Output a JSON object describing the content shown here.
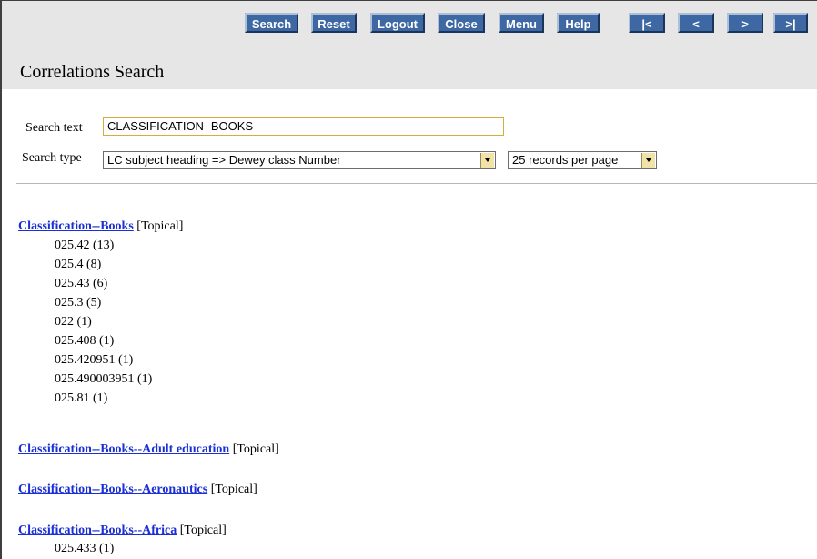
{
  "toolbar": {
    "buttons": [
      "Search",
      "Reset",
      "Logout",
      "Close",
      "Menu",
      "Help"
    ],
    "nav": [
      "|<",
      "<",
      ">",
      ">|"
    ]
  },
  "page_title": "Correlations Search",
  "search": {
    "text_label": "Search text",
    "text_value": "CLASSIFICATION- BOOKS",
    "type_label": "Search type",
    "type_value": "LC subject heading => Dewey class Number",
    "per_page_value": "25 records per page"
  },
  "results": [
    {
      "heading": "Classification--Books",
      "tag": "[Topical]",
      "numbers": [
        "025.42 (13)",
        "025.4 (8)",
        "025.43 (6)",
        "025.3 (5)",
        "022 (1)",
        "025.408 (1)",
        "025.420951 (1)",
        "025.490003951 (1)",
        "025.81 (1)"
      ]
    },
    {
      "heading": "Classification--Books--Adult education",
      "tag": "[Topical]",
      "numbers": []
    },
    {
      "heading": "Classification--Books--Aeronautics",
      "tag": "[Topical]",
      "numbers": []
    },
    {
      "heading": "Classification--Books--Africa",
      "tag": "[Topical]",
      "numbers": [
        "025.433 (1)"
      ]
    }
  ]
}
